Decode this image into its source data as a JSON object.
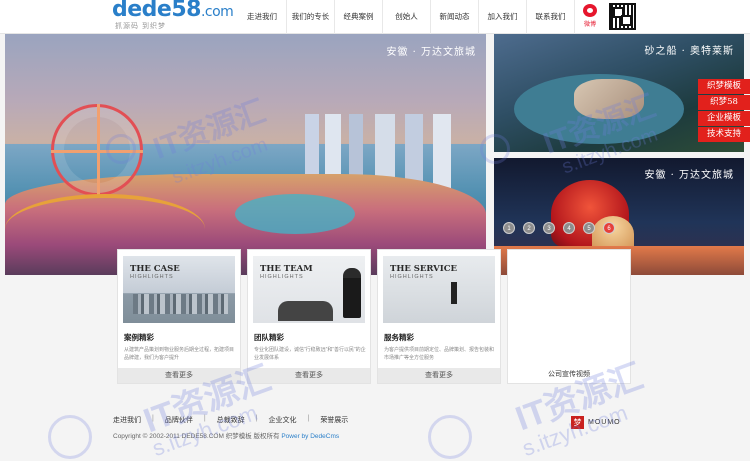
{
  "header": {
    "logo": {
      "main": "dede58",
      "dotcom": ".com",
      "slogan": "抓源码 到织梦"
    },
    "nav": [
      {
        "label": "走进我们"
      },
      {
        "label": "我们的专长"
      },
      {
        "label": "经典案例"
      },
      {
        "label": "创始人"
      },
      {
        "label": "新闻动态"
      },
      {
        "label": "加入我们"
      },
      {
        "label": "联系我们"
      }
    ],
    "weibo_label": "微博"
  },
  "banner": {
    "main_caption": "安徽 · 万达文旅城",
    "right_top_caption": "砂之船 · 奥特莱斯",
    "right_bottom_caption": "安徽 · 万达文旅城",
    "dots": [
      "1",
      "2",
      "3",
      "4",
      "5",
      "6"
    ],
    "active_dot": 6
  },
  "side_tags": [
    "织梦模板",
    "织梦58",
    "企业模板",
    "技术支持"
  ],
  "cards": [
    {
      "img_title": "THE CASE",
      "img_sub": "HIGHLIGHTS",
      "title": "案例精彩",
      "desc": "从建筑产品策划到物业服务后期全过程，拓建项目品牌建，我们为客户提升",
      "more": "查看更多"
    },
    {
      "img_title": "THE TEAM",
      "img_sub": "HIGHLIGHTS",
      "title": "团队精彩",
      "desc": "专业化团队建设，诚信“行稳致远”和“善行以民”的企业发展体系",
      "more": "查看更多"
    },
    {
      "img_title": "THE SERVICE",
      "img_sub": "HIGHLIGHTS",
      "title": "服务精彩",
      "desc": "为客户提供项目前期定位、品牌策划、报告包装和市场推广等全方位服务",
      "more": "查看更多"
    }
  ],
  "video_card": {
    "label": "公司宣传视频"
  },
  "footer": {
    "links": [
      "走进我们",
      "品牌伙伴",
      "总裁致辞",
      "企业文化",
      "荣誉展示"
    ],
    "copyright": "Copyright © 2002-2011 DEDE58.COM 织梦模板 版权所有",
    "powered": "Power by DedeCms",
    "moumo_seal": "梦",
    "moumo_text": "MOUMO"
  },
  "watermark": {
    "text": "IT资源汇",
    "sub": "s.itzyh.com"
  },
  "colors": {
    "brand_blue": "#2a7fc9",
    "accent_red": "#e2211c",
    "watermark": "#6e7ddc"
  }
}
